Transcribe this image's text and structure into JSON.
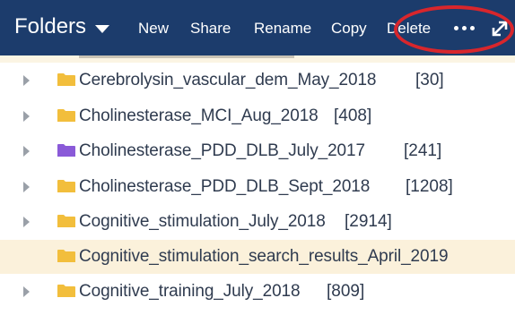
{
  "toolbar": {
    "folders_label": "Folders",
    "new_label": "New",
    "share_label": "Share",
    "rename_label": "Rename",
    "copy_label": "Copy",
    "delete_label": "Delete",
    "more_icon": "ellipsis-icon",
    "expand_icon": "expand-arrows-icon",
    "annotation_color": "#d8262c",
    "bar_color": "#1c3c6c"
  },
  "folders": [
    {
      "name": "Cerebrolysin_vascular_dem_May_2018",
      "count": "[30]",
      "color": "#f2be3c",
      "expandable": true
    },
    {
      "name": "Cholinesterase_MCI_Aug_2018",
      "count": "[408]",
      "color": "#f2be3c",
      "expandable": true
    },
    {
      "name": "Cholinesterase_PDD_DLB_July_2017",
      "count": "[241]",
      "color": "#8a5ad8",
      "expandable": true
    },
    {
      "name": "Cholinesterase_PDD_DLB_Sept_2018",
      "count": "[1208]",
      "color": "#f2be3c",
      "expandable": true
    },
    {
      "name": "Cognitive_stimulation_July_2018",
      "count": "[2914]",
      "color": "#f2be3c",
      "expandable": true
    },
    {
      "name": "Cognitive_stimulation_search_results_April_2019",
      "count": "",
      "color": "#f2be3c",
      "expandable": false,
      "selected": true
    },
    {
      "name": "Cognitive_training_July_2018",
      "count": "[809]",
      "color": "#f2be3c",
      "expandable": true
    }
  ]
}
